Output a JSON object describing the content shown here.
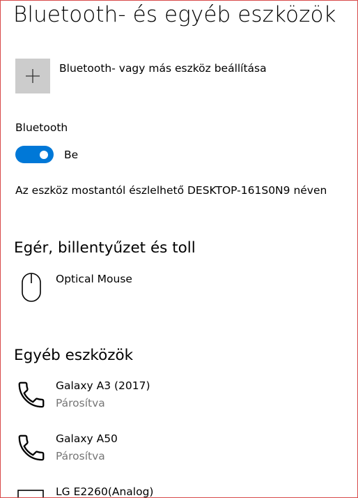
{
  "page": {
    "title": "Bluetooth- és egyéb eszközök"
  },
  "add_device": {
    "label": "Bluetooth- vagy más eszköz beállítása",
    "icon": "plus-icon"
  },
  "bluetooth": {
    "label": "Bluetooth",
    "toggle_state": "Be",
    "toggle_on": true,
    "discoverable_text": "Az eszköz mostantól észlelhető DESKTOP-161S0N9 néven"
  },
  "sections": {
    "mouse": {
      "heading": "Egér, billentyűzet és toll",
      "devices": [
        {
          "name": "Optical Mouse",
          "icon": "mouse-icon"
        }
      ]
    },
    "other": {
      "heading": "Egyéb eszközök",
      "devices": [
        {
          "name": "Galaxy A3 (2017)",
          "status": "Párosítva",
          "icon": "phone-icon"
        },
        {
          "name": "Galaxy A50",
          "status": "Párosítva",
          "icon": "phone-icon"
        },
        {
          "name": "LG E2260(Analog)",
          "icon": "monitor-icon"
        }
      ]
    }
  },
  "colors": {
    "accent": "#0078d7",
    "tile": "#cccccc",
    "secondary_text": "#767676",
    "frame_border": "#d84a4a"
  }
}
